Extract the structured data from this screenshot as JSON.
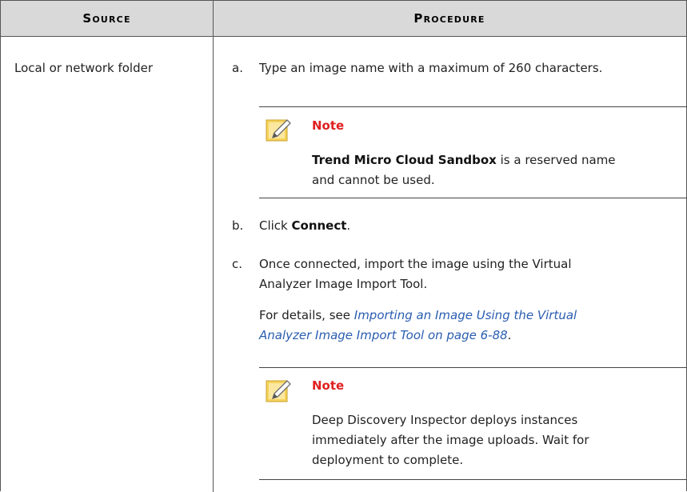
{
  "header": {
    "source": "Source",
    "procedure": "Procedure"
  },
  "row": {
    "source": "Local or network folder",
    "steps": [
      {
        "letter": "a.",
        "text": "Type an image name with a maximum of 260 characters."
      },
      {
        "letter": "b.",
        "prefix": "Click ",
        "bold": "Connect",
        "suffix": "."
      },
      {
        "letter": "c.",
        "text_line1": "Once connected, import the image using the Virtual",
        "text_line2": "Analyzer Image Import Tool."
      }
    ],
    "details": {
      "prefix": "For details, see ",
      "link_line1": "Importing an Image Using the Virtual",
      "link_line2": "Analyzer Image Import Tool on page 6-88",
      "suffix": "."
    },
    "note1": {
      "title": "Note",
      "bold": "Trend Micro Cloud Sandbox",
      "text_line1_rest": " is a reserved name",
      "text_line2": "and cannot be used."
    },
    "note2": {
      "title": "Note",
      "line1": "Deep Discovery Inspector deploys instances",
      "line2": "immediately after the image uploads. Wait for",
      "line3": "deployment to complete."
    }
  },
  "colors": {
    "header_bg": "#d9d9d9",
    "note_title": "#e02020",
    "link": "#2a5db0",
    "note_icon_fill": "#f6d35b"
  }
}
